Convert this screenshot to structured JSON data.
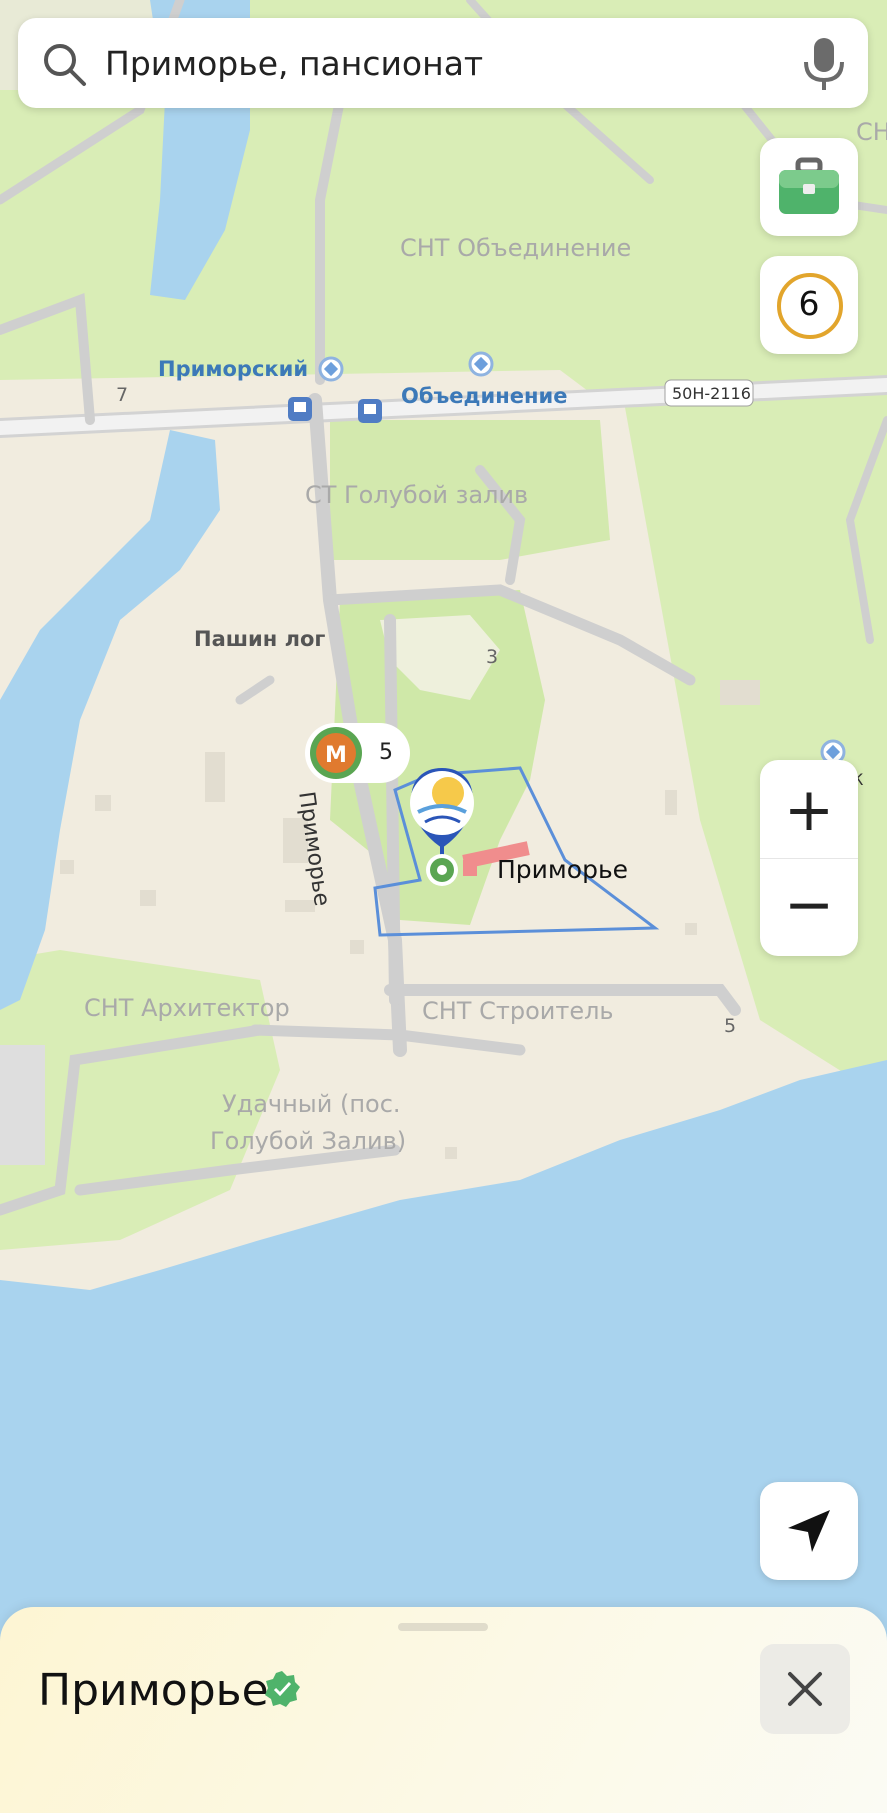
{
  "search": {
    "query": "Приморье, пансионат",
    "search_icon": "search-icon",
    "mic_icon": "microphone-icon"
  },
  "controls": {
    "briefcase_icon": "briefcase-icon",
    "counter_value": "6",
    "zoom_in_label": "+",
    "zoom_out_label": "−",
    "locate_icon": "navigation-arrow-icon",
    "close_icon": "close-icon"
  },
  "map": {
    "labels": {
      "snt_obedinenie": "СНТ Объединение",
      "st_goluboy_zaliv": "СТ Голубой залив",
      "pashin_log": "Пашин лог",
      "snt_arkhitektor": "СНТ Архитектор",
      "snt_stroitel": "СНТ Строитель",
      "udachny_line1": "Удачный (пос.",
      "udachny_line2": "Голубой Залив)",
      "stop_primorsky": "Приморский",
      "stop_obedinenie": "Объединение",
      "road_number": "50Н-2116",
      "street_name": "Приморье",
      "poi_name": "Приморье",
      "house_7": "7",
      "house_3": "3",
      "house_5_right": "5",
      "metro_count": "5",
      "edge_ch": "СН",
      "edge_k": "К"
    },
    "colors": {
      "water": "#a9d3ee",
      "green": "#d7ecb2",
      "land": "#f1ecdf",
      "road": "#cdcdcd",
      "boundary": "#5b8fd9"
    }
  },
  "sheet": {
    "title": "Приморье",
    "badge_icon": "verified-badge-icon"
  }
}
